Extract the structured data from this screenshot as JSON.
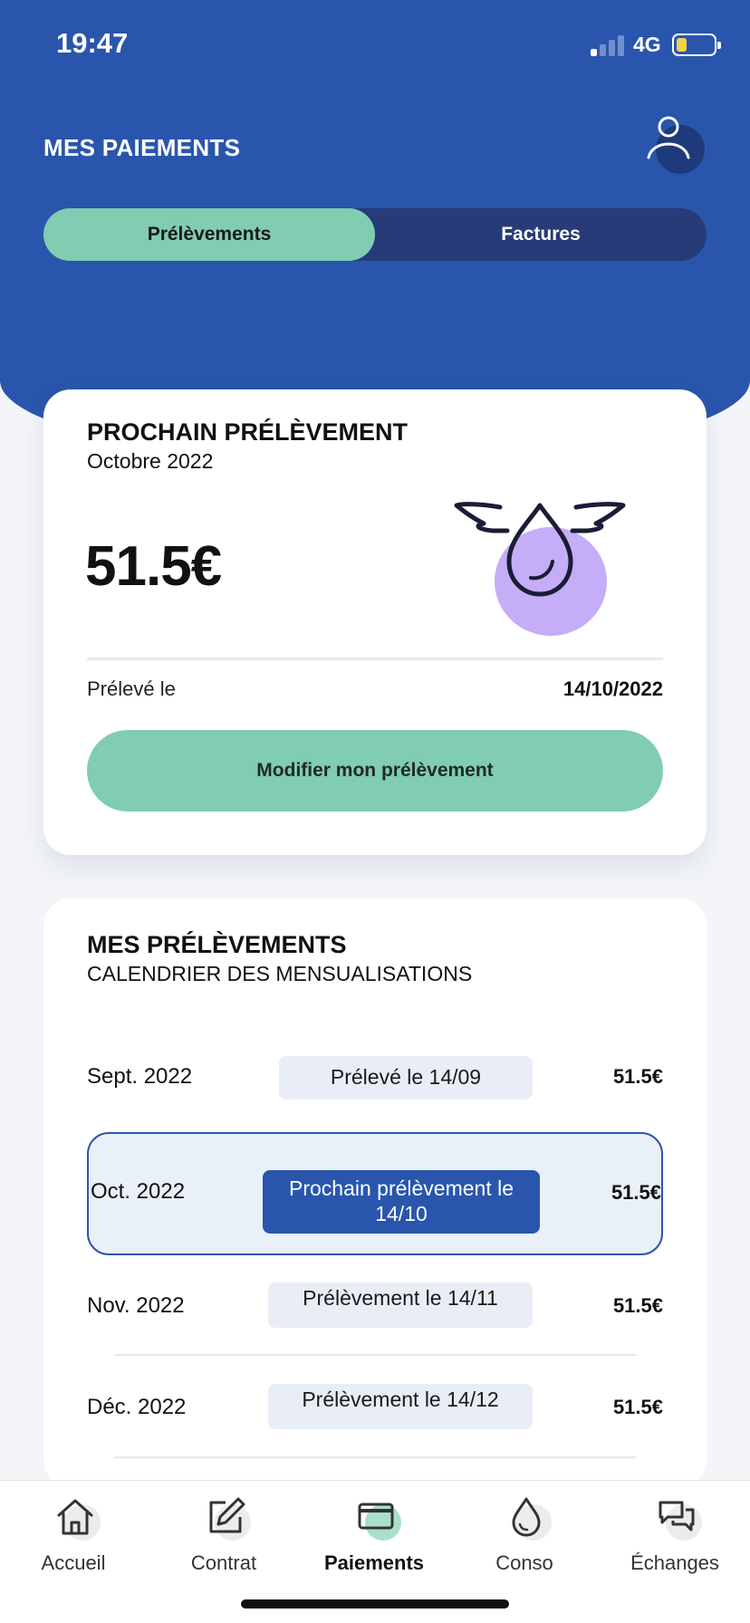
{
  "status_bar": {
    "time": "19:47",
    "network": "4G"
  },
  "header": {
    "title": "MES PAIEMENTS"
  },
  "segments": {
    "active": "Prélèvements",
    "inactive": "Factures"
  },
  "next_debit": {
    "title": "PROCHAIN PRÉLÈVEMENT",
    "subtitle": "Octobre 2022",
    "amount": "51.5€",
    "debited_label": "Prélevé le",
    "debited_date": "14/10/2022",
    "modify_button": "Modifier mon prélèvement"
  },
  "schedule": {
    "title": "MES PRÉLÈVEMENTS",
    "subtitle": "CALENDRIER DES MENSUALISATIONS",
    "rows": [
      {
        "month": "Sept. 2022",
        "status": "Prélevé le 14/09",
        "amount": "51.5€"
      },
      {
        "month": "Oct. 2022",
        "status": "Prochain prélèvement le 14/10",
        "amount": "51.5€"
      },
      {
        "month": "Nov. 2022",
        "status": "Prélèvement le 14/11",
        "amount": "51.5€"
      },
      {
        "month": "Déc. 2022",
        "status": "Prélèvement le 14/12",
        "amount": "51.5€"
      }
    ]
  },
  "tabbar": {
    "items": [
      {
        "label": "Accueil",
        "icon": "home-icon"
      },
      {
        "label": "Contrat",
        "icon": "edit-icon"
      },
      {
        "label": "Paiements",
        "icon": "card-icon"
      },
      {
        "label": "Conso",
        "icon": "drop-icon"
      },
      {
        "label": "Échanges",
        "icon": "chat-icon"
      }
    ],
    "active": "Paiements"
  },
  "colors": {
    "primary": "#2956ac",
    "accent_green": "#80cdb2",
    "purple": "#c5adf7",
    "segment_bg": "#263b78"
  }
}
